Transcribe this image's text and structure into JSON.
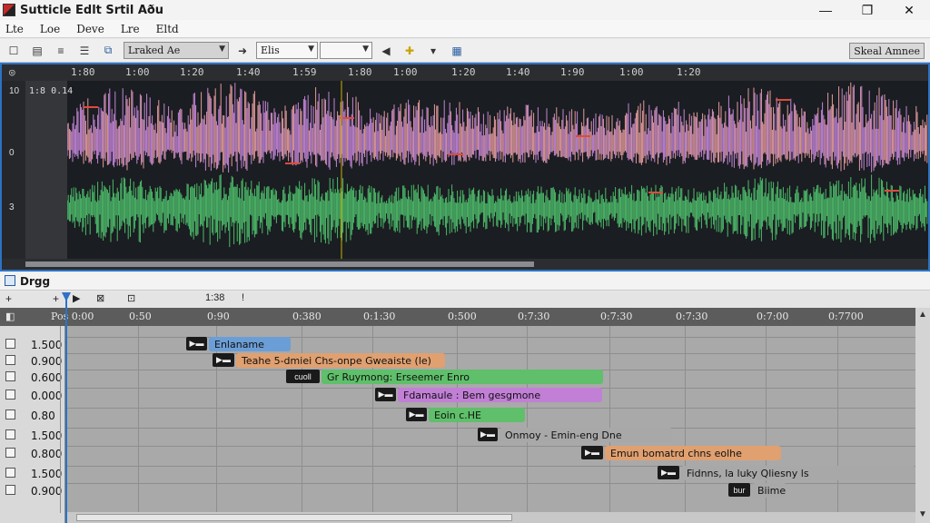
{
  "window": {
    "title": "Sutticle Edlt Srtil Aðu",
    "controls": {
      "minimize": "—",
      "maximize": "❐",
      "close": "✕"
    }
  },
  "menu": [
    "Lte",
    "Loe",
    "Deve",
    "Lre",
    "Eltd"
  ],
  "toolbar": {
    "font_combo": "Lraked Ae",
    "style_combo": "Elis",
    "size_combo": "",
    "spectrogram_button": "Skeal Amnee"
  },
  "waveform": {
    "current_time": "1:8 0.14",
    "ruler_labels": [
      "1:80",
      "1:00",
      "1:20",
      "1:40",
      "1:59",
      "1:80",
      "1:00",
      "1:20",
      "1:40",
      "1:90",
      "1:00",
      "1:20"
    ],
    "amplitude_labels": [
      "10",
      "0",
      "3"
    ],
    "colors": {
      "background": "#1a1d21",
      "pink": "#e39b9e",
      "violet": "#c385d8",
      "green": "#4dbb6a"
    }
  },
  "list_panel": {
    "title": "Drgg",
    "toolbar_items": [
      "+",
      "+",
      "1:38",
      "!"
    ],
    "ruler_labels": [
      "Pos 0:00",
      "0:50",
      "0:90",
      "0:380",
      "0:1:30",
      "0:500",
      "0:7:30",
      "0:7:30",
      "0:7:30",
      "0:7:00",
      "0:7700"
    ],
    "rows": [
      "1.500",
      "0.900",
      "0.600",
      "0.000",
      "0.80",
      "1.500",
      "0.800",
      "1.500",
      "0.900"
    ],
    "segments": [
      {
        "text": "Enlaname",
        "color": "#6b9ed6",
        "badge": "▶▬",
        "row": 0
      },
      {
        "text": "Teahe 5-dmiei Chs-onpe Gweaiste (le)",
        "color": "#e0a070",
        "badge": "▶▬",
        "row": 1
      },
      {
        "text": "Gr Ruymong: Erseemer Enro",
        "color": "#5fbf6a",
        "badge": "cuoll",
        "row": 2
      },
      {
        "text": "Fdamaule : Bem gesgmone",
        "color": "#c27fd6",
        "badge": "▶▬",
        "row": 3
      },
      {
        "text": "Eoin c.HE",
        "color": "#5fbf6a",
        "badge": "▶▬",
        "row": 4
      },
      {
        "text": "Onmoy - Emin-eng Dne",
        "color": "#a8a8a8",
        "badge": "▶▬",
        "row": 5
      },
      {
        "text": "Emun bomatrd chns eolhe",
        "color": "#e0a070",
        "badge": "▶▬",
        "row": 6
      },
      {
        "text": "Fidnns, la luky Qliesny ls",
        "color": "#a8a8a8",
        "badge": "▶▬",
        "row": 7
      },
      {
        "text": "Biimel",
        "color": "#a8a8a8",
        "badge": "bur",
        "row": 8
      }
    ]
  }
}
